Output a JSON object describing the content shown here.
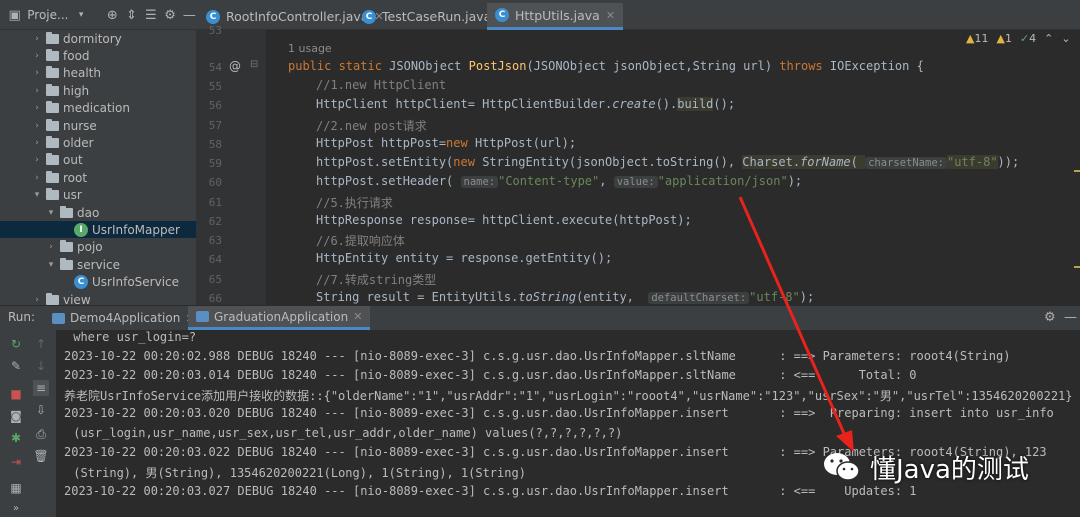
{
  "header": {
    "project_label": "Proje...",
    "tabs": [
      {
        "label": "RootInfoController.java",
        "active": false
      },
      {
        "label": "TestCaseRun.java",
        "active": false
      },
      {
        "label": "HttpUtils.java",
        "active": true
      }
    ]
  },
  "tree": [
    {
      "label": "dormitory",
      "type": "folder",
      "indent": 1
    },
    {
      "label": "food",
      "type": "folder",
      "indent": 1
    },
    {
      "label": "health",
      "type": "folder",
      "indent": 1
    },
    {
      "label": "high",
      "type": "folder",
      "indent": 1
    },
    {
      "label": "medication",
      "type": "folder",
      "indent": 1
    },
    {
      "label": "nurse",
      "type": "folder",
      "indent": 1
    },
    {
      "label": "older",
      "type": "folder",
      "indent": 1
    },
    {
      "label": "out",
      "type": "folder",
      "indent": 1
    },
    {
      "label": "root",
      "type": "folder",
      "indent": 1
    },
    {
      "label": "usr",
      "type": "folder",
      "indent": 1,
      "expanded": true
    },
    {
      "label": "dao",
      "type": "folder",
      "indent": 2,
      "expanded": true
    },
    {
      "label": "UsrInfoMapper",
      "type": "interface",
      "indent": 3,
      "selected": true
    },
    {
      "label": "pojo",
      "type": "folder",
      "indent": 2
    },
    {
      "label": "service",
      "type": "folder",
      "indent": 2,
      "expanded": true
    },
    {
      "label": "UsrInfoService",
      "type": "class",
      "indent": 3
    },
    {
      "label": "view",
      "type": "folder",
      "indent": 1
    }
  ],
  "editor": {
    "usage_hint": "1 usage",
    "warnings": {
      "warn_count": "11",
      "weak_count": "1",
      "ok_count": "4"
    },
    "line_numbers": [
      "53",
      "54",
      "55",
      "56",
      "57",
      "58",
      "59",
      "60",
      "61",
      "62",
      "63",
      "64",
      "65",
      "66"
    ],
    "lines": {
      "l54": {
        "kw1": "public static ",
        "type": "JSONObject ",
        "fn": "PostJson",
        "params": "(JSONObject jsonObject,String url) ",
        "kw2": "throws ",
        "rest": "IOException {"
      },
      "l55": "//1.new HttpClient",
      "l56": {
        "a": "HttpClient httpClient= HttpClientBuilder.",
        "b": "create",
        "c": "().",
        "d": "build",
        "e": "();"
      },
      "l57": "//2.new post请求",
      "l58": {
        "a": "HttpPost httpPost=",
        "b": "new ",
        "c": "HttpPost(url);"
      },
      "l59": {
        "a": "httpPost.setEntity(",
        "b": "new ",
        "c": "StringEntity(jsonObject.toString(), ",
        "d": "Charset.",
        "e": "forName",
        "f": "( ",
        "hint": "charsetName:",
        "str": "\"utf-8\"",
        "g": "));"
      },
      "l60": {
        "a": "httpPost.setHeader( ",
        "hint1": "name:",
        "str1": "\"Content-type\"",
        "c": ", ",
        "hint2": "value:",
        "str2": "\"application/json\"",
        "d": ");"
      },
      "l61": "//5.执行请求",
      "l62": "HttpResponse response= httpClient.execute(httpPost);",
      "l63": "//6.提取响应体",
      "l64": "HttpEntity entity = response.getEntity();",
      "l65": "//7.转成string类型",
      "l66": {
        "a": "String result = EntityUtils.",
        "b": "toString",
        "c": "(entity,  ",
        "hint": "defaultCharset:",
        "str": "\"utf-8\"",
        "d": ");"
      }
    }
  },
  "run": {
    "label": "Run:",
    "tabs": [
      {
        "label": "Demo4Application",
        "active": false
      },
      {
        "label": "GraduationApplication",
        "active": true
      }
    ],
    "console": [
      " where usr_login=?",
      "2023-10-22 00:20:02.988 DEBUG 18240 --- [nio-8089-exec-3] c.s.g.usr.dao.UsrInfoMapper.sltName      : ==> Parameters: rooot4(String)",
      "2023-10-22 00:20:03.014 DEBUG 18240 --- [nio-8089-exec-3] c.s.g.usr.dao.UsrInfoMapper.sltName      : <==      Total: 0",
      "养老院UsrInfoService添加用户接收的数据::{\"olderName\":\"1\",\"usrAddr\":\"1\",\"usrLogin\":\"rooot4\",\"usrName\":\"123\",\"usrSex\":\"男\",\"usrTel\":1354620200221}",
      "2023-10-22 00:20:03.020 DEBUG 18240 --- [nio-8089-exec-3] c.s.g.usr.dao.UsrInfoMapper.insert       : ==>  Preparing: insert into usr_info",
      " (usr_login,usr_name,usr_sex,usr_tel,usr_addr,older_name) values(?,?,?,?,?,?)",
      "2023-10-22 00:20:03.022 DEBUG 18240 --- [nio-8089-exec-3] c.s.g.usr.dao.UsrInfoMapper.insert       : ==> Parameters: rooot4(String), 123",
      " (String), 男(String), 1354620200221(Long), 1(String), 1(String)",
      "2023-10-22 00:20:03.027 DEBUG 18240 --- [nio-8089-exec-3] c.s.g.usr.dao.UsrInfoMapper.insert       : <==    Updates: 1"
    ]
  },
  "watermark": "懂Java的测试",
  "colors": {
    "accent": "#4a88c7",
    "annotation_arrow": "#e8221c"
  }
}
